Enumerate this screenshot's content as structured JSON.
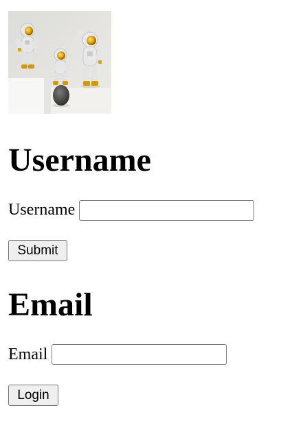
{
  "image": {
    "alt": "astronaut-figurines-photo"
  },
  "username_section": {
    "heading": "Username",
    "field_label": "Username",
    "input_value": "",
    "button_label": "Submit"
  },
  "email_section": {
    "heading": "Email",
    "field_label": "Email",
    "input_value": "",
    "button_label": "Login"
  },
  "colors": {
    "button_bg": "#efefef",
    "border": "#767676",
    "text": "#000000",
    "background": "#ffffff"
  }
}
